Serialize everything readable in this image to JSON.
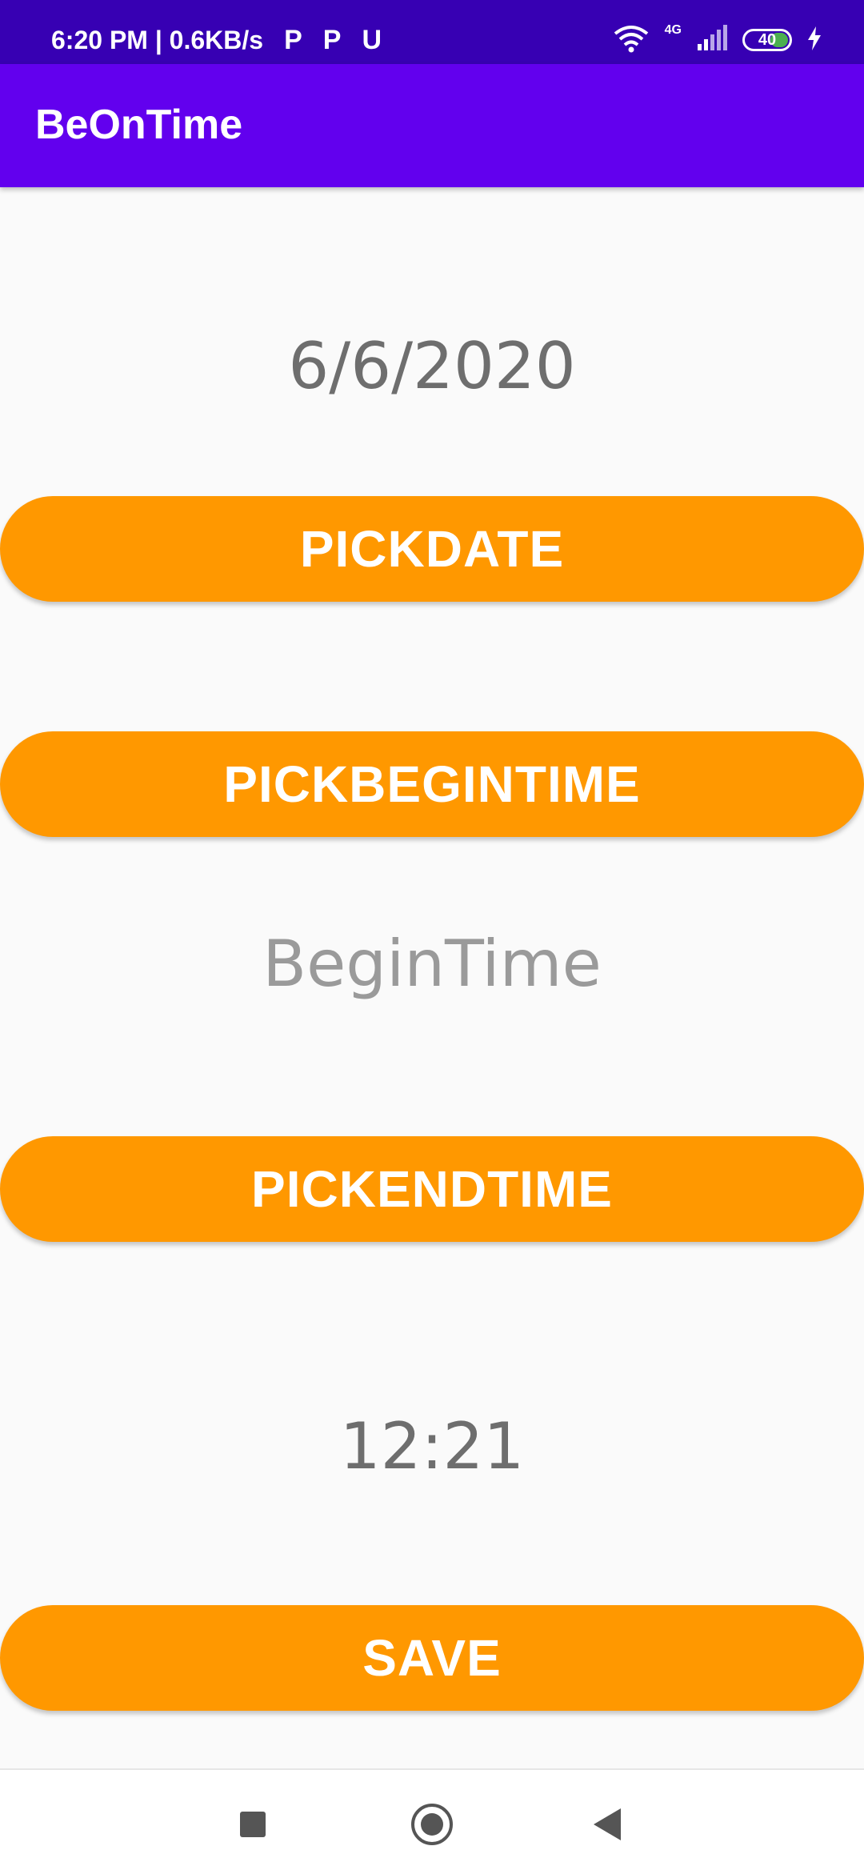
{
  "status_bar": {
    "time_speed": "6:20 PM | 0.6KB/s",
    "app_icons": [
      "P",
      "P",
      "U"
    ],
    "network": "4G",
    "battery": "40",
    "battery_level_percent": 40,
    "icons": [
      "wifi-icon",
      "signal-icon",
      "battery-icon",
      "charging-icon"
    ]
  },
  "app_bar": {
    "title": "BeOnTime"
  },
  "main": {
    "date_value": "6/6/2020",
    "pick_date_label": "PICKDATE",
    "pick_begin_time_label": "PICKBEGINTIME",
    "begin_time_hint": "BeginTime",
    "pick_end_time_label": "PICKENDTIME",
    "end_time_value": "12:21",
    "save_label": "SAVE"
  },
  "nav_bar": {
    "icons": [
      "recents-square-icon",
      "home-circle-icon",
      "back-triangle-icon"
    ]
  },
  "colors": {
    "status_bar": "#3700b3",
    "app_bar": "#6200ee",
    "button": "#ff9800",
    "background": "#fafafa"
  }
}
